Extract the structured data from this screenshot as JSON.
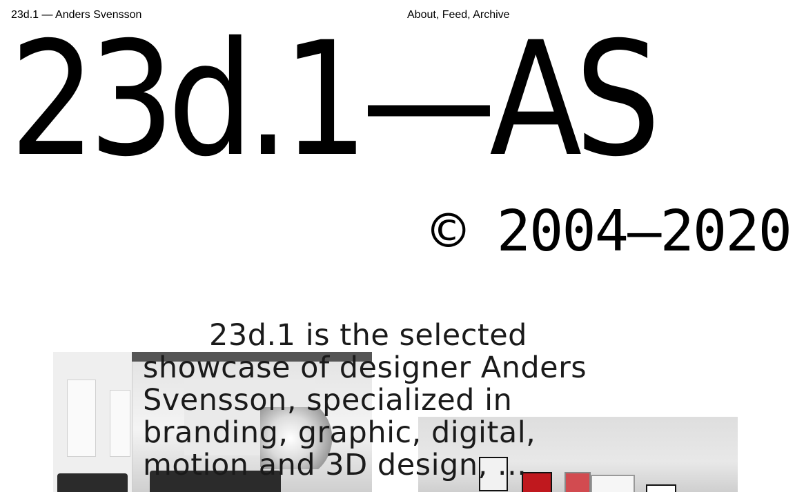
{
  "header": {
    "site_name": "23d.1 — Anders Svensson",
    "nav": [
      "About",
      "Feed",
      "Archive"
    ],
    "nav_separator": ", "
  },
  "hero": {
    "title": "23d.1—AS",
    "copyright": "© 2004–2020"
  },
  "intro": {
    "text": "23d.1 is the selected showcase of designer Anders Svensson, specialized in branding, graphic, digital, motion and 3D design, ..."
  },
  "colors": {
    "background": "#ffffff",
    "text": "#000000"
  }
}
